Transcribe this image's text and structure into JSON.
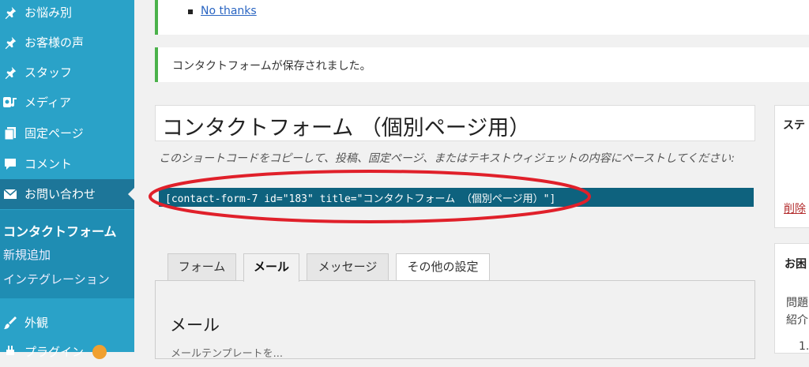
{
  "sidebar": {
    "items": [
      {
        "label": "お悩み別",
        "icon": "pin-icon"
      },
      {
        "label": "お客様の声",
        "icon": "pin-icon"
      },
      {
        "label": "スタッフ",
        "icon": "pin-icon"
      },
      {
        "label": "メディア",
        "icon": "media-icon"
      },
      {
        "label": "固定ページ",
        "icon": "page-icon"
      },
      {
        "label": "コメント",
        "icon": "comment-icon"
      },
      {
        "label": "お問い合わせ",
        "icon": "mail-icon"
      },
      {
        "label": "外観",
        "icon": "brush-icon"
      },
      {
        "label": "プラグイン",
        "icon": "plugin-icon"
      }
    ],
    "submenu": [
      "コンタクトフォーム",
      "新規追加",
      "インテグレーション"
    ]
  },
  "notices": {
    "no_thanks": "No thanks",
    "saved": "コンタクトフォームが保存されました。"
  },
  "form": {
    "title": "コンタクトフォーム （個別ページ用）",
    "shortcode_note": "このショートコードをコピーして、投稿、固定ページ、またはテキストウィジェットの内容にペーストしてください:",
    "shortcode": "[contact-form-7 id=\"183\" title=\"コンタクトフォーム （個別ページ用）\"]"
  },
  "tabs": [
    "フォーム",
    "メール",
    "メッセージ",
    "その他の設定"
  ],
  "panel": {
    "heading": "メール",
    "subtext": "メールテンプレートを..."
  },
  "right": {
    "status_head": "ステ",
    "delete": "削除",
    "help_head": "お困",
    "help_line1": "問題",
    "help_line2": "紹介",
    "help_item1": "1."
  },
  "colors": {
    "sidebar": "#2aa2c8",
    "active": "#1d7699",
    "shortcode_bg": "#0e627e",
    "annotation": "#e0202a"
  }
}
